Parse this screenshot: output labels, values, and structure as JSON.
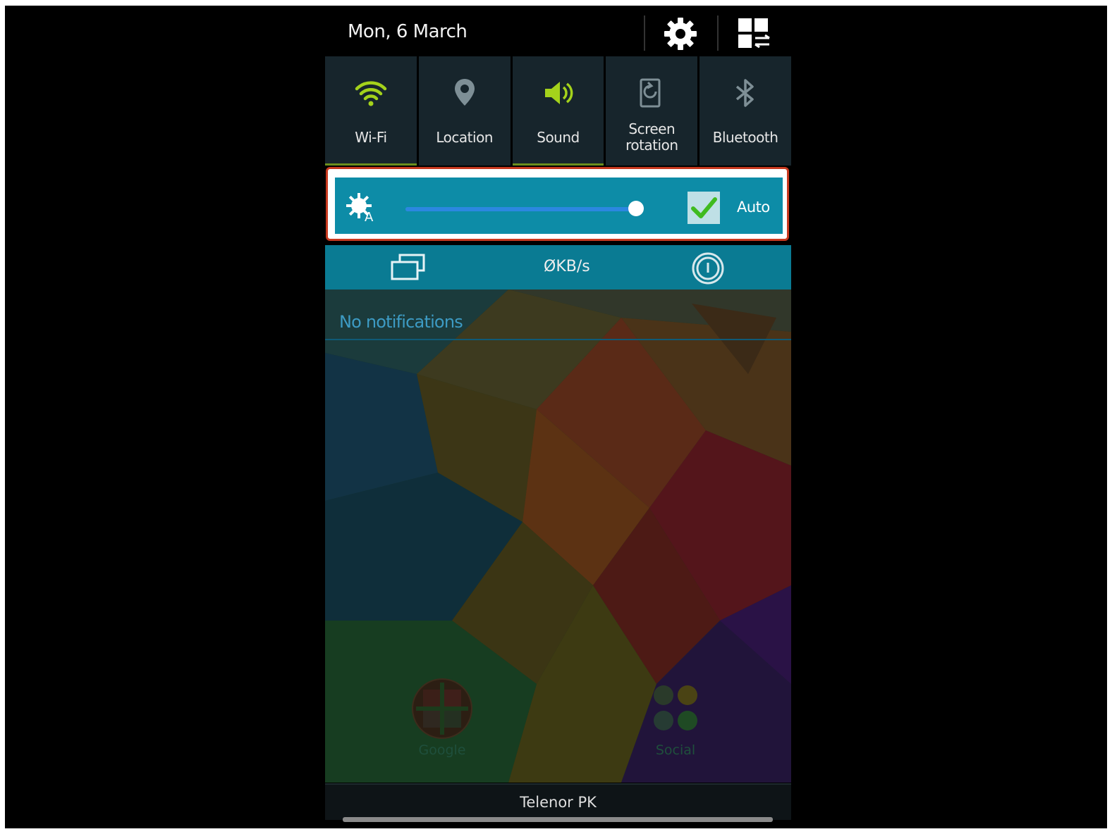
{
  "header": {
    "date": "Mon, 6 March"
  },
  "icons": {
    "settings": "gear-icon",
    "quick_settings_edit": "grid-swap-icon"
  },
  "toggles": [
    {
      "label": "Wi-Fi",
      "icon": "wifi-icon",
      "on": true
    },
    {
      "label": "Location",
      "icon": "location-pin-icon",
      "on": false
    },
    {
      "label": "Sound",
      "icon": "speaker-icon",
      "on": true
    },
    {
      "label": "Screen rotation",
      "icon": "screen-rotation-icon",
      "on": false
    },
    {
      "label": "Bluetooth",
      "icon": "bluetooth-icon",
      "on": false
    }
  ],
  "brightness": {
    "level": 0.99,
    "auto_checked": true,
    "auto_label": "Auto"
  },
  "info_bar": {
    "net_speed": "ØKB/s"
  },
  "notifications": {
    "empty_text": "No notifications"
  },
  "home_folders": [
    {
      "label": "Google"
    },
    {
      "label": "Social"
    }
  ],
  "carrier": "Telenor PK",
  "colors": {
    "toggle_on": "#a4d21b",
    "toggle_off": "#7e8f96",
    "brightness_bar": "#0d8ca7",
    "highlight_outline": "#c8391f",
    "checkmark": "#3fbb1f"
  }
}
